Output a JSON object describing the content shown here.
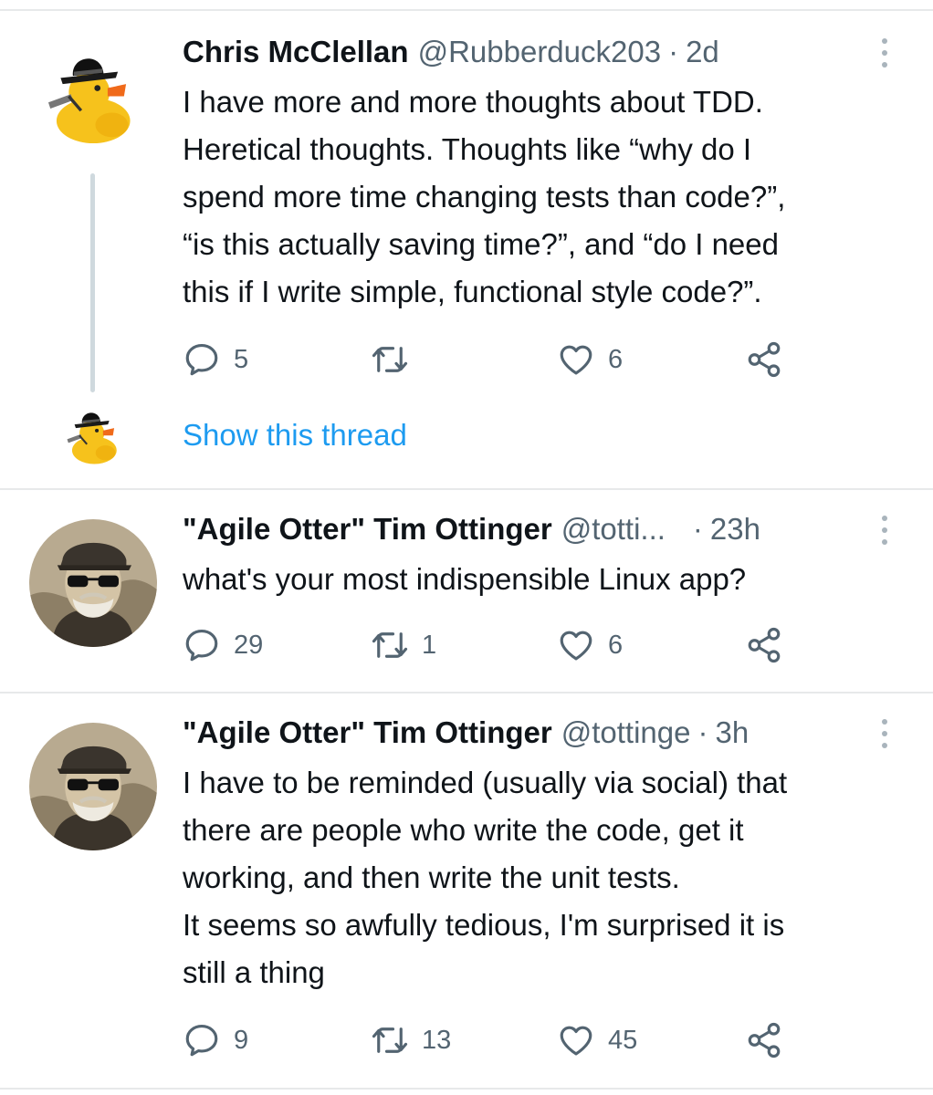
{
  "tweets": [
    {
      "name": "Chris McClellan",
      "handle": "@Rubberduck203",
      "separator": "·",
      "time": "2d",
      "lines": [
        "I have more and more thoughts about TDD.",
        "Heretical thoughts. Thoughts like “why do I",
        "spend more time changing tests than code?”,",
        "“is this actually saving time?”, and “do I need",
        "this if I write simple, functional style code?”."
      ],
      "replies": "5",
      "retweets": "",
      "likes": "6",
      "show_thread": "Show this thread"
    },
    {
      "name": "\"Agile Otter\" Tim Ottinger",
      "handle": "@totti...",
      "separator": "·",
      "time": "23h",
      "lines": [
        "what's your most indispensible Linux app?"
      ],
      "replies": "29",
      "retweets": "1",
      "likes": "6"
    },
    {
      "name": "\"Agile Otter\" Tim Ottinger",
      "handle": "@tottinge",
      "separator": "·",
      "time": "3h",
      "lines": [
        "I have to be reminded (usually via social) that",
        "there are people who write the code, get it",
        "working, and then write the unit tests.",
        "It seems so awfully tedious, I'm surprised it is",
        "still a thing"
      ],
      "replies": "9",
      "retweets": "13",
      "likes": "45"
    }
  ],
  "icons": {
    "reply": "reply-icon",
    "retweet": "retweet-icon",
    "like": "heart-icon",
    "share": "share-icon",
    "more": "more-vertical-icon"
  },
  "colors": {
    "text": "#0f1419",
    "secondary": "#536471",
    "link": "#1d9bf0",
    "divider": "#e7e9ea"
  }
}
